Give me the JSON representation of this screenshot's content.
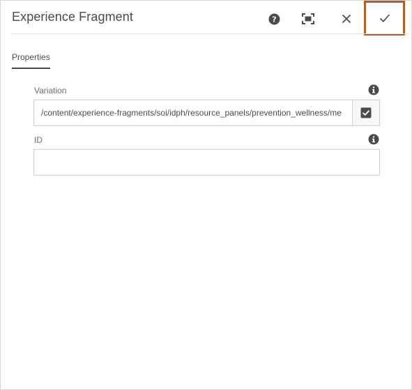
{
  "dialog": {
    "title": "Experience Fragment",
    "buttons": {
      "help_icon": "help-icon",
      "fullscreen_icon": "fullscreen-icon",
      "close_icon": "close-icon",
      "done_icon": "checkmark-icon",
      "done_highlight_color": "#b45d27"
    }
  },
  "tabs": [
    {
      "label": "Properties",
      "active": true
    }
  ],
  "fields": {
    "variation": {
      "label": "Variation",
      "value": "/content/experience-fragments/soi/idph/resource_panels/prevention_wellness/me",
      "info_icon": "info-icon",
      "picker_icon": "checkbox-icon"
    },
    "id": {
      "label": "ID",
      "value": "",
      "info_icon": "info-icon"
    }
  }
}
